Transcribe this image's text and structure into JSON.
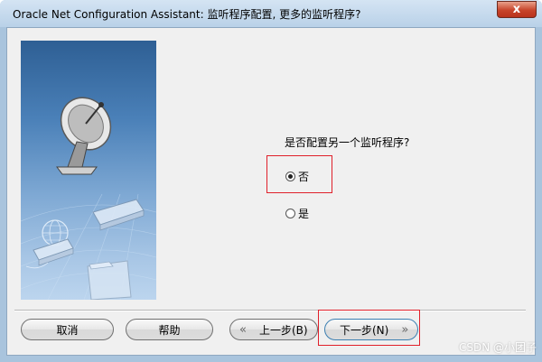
{
  "window": {
    "title": "Oracle Net Configuration Assistant: 监听程序配置, 更多的监听程序?",
    "close_label": "x"
  },
  "main": {
    "question": "是否配置另一个监听程序?",
    "options": [
      {
        "label": "否",
        "selected": true
      },
      {
        "label": "是",
        "selected": false
      }
    ]
  },
  "footer": {
    "cancel_label": "取消",
    "help_label": "帮助",
    "back_label": "上一步(B)",
    "back_glyph": "«",
    "next_label": "下一步(N)",
    "next_glyph": "»"
  },
  "watermark": "CSDN @小团子",
  "colors": {
    "highlight_box": "#e0202a",
    "close_button": "#c7442a"
  },
  "icons": [
    "satellite-dish-icon",
    "globe-icon",
    "network-device-icon",
    "folder-icon"
  ]
}
